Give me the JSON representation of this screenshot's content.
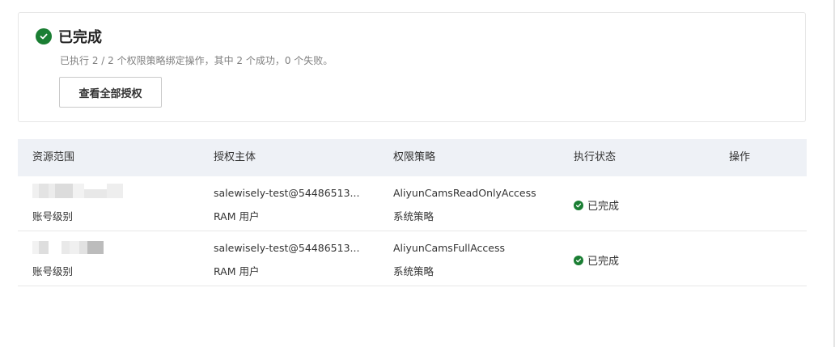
{
  "result": {
    "status_title": "已完成",
    "summary": "已执行 2 / 2 个权限策略绑定操作，其中 2 个成功，0 个失败。",
    "view_all_label": "查看全部授权"
  },
  "table": {
    "headers": [
      "资源范围",
      "授权主体",
      "权限策略",
      "执行状态",
      "操作"
    ],
    "rows": [
      {
        "scope_level": "账号级别",
        "principal": "salewisely-test@54486513...",
        "principal_type": "RAM 用户",
        "policy": "AliyunCamsReadOnlyAccess",
        "policy_type": "系统策略",
        "status": "已完成"
      },
      {
        "scope_level": "账号级别",
        "principal": "salewisely-test@54486513...",
        "principal_type": "RAM 用户",
        "policy": "AliyunCamsFullAccess",
        "policy_type": "系统策略",
        "status": "已完成"
      }
    ]
  },
  "colors": {
    "success": "#1a7e33",
    "header_bg": "#eef1f6",
    "border": "#e6e6e6"
  },
  "icons": {
    "status_icon": "check-circle-icon",
    "row_status_icon": "check-circle-small-icon"
  }
}
